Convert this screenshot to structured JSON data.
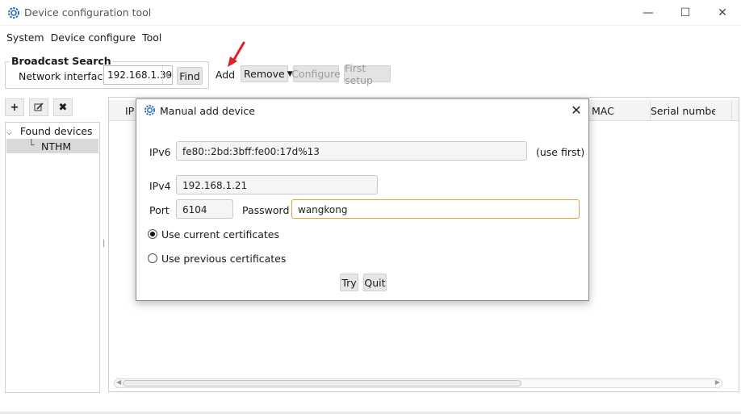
{
  "window": {
    "title": "Device configuration tool",
    "minimize_glyph": "—",
    "maximize_glyph": "☐",
    "close_glyph": "✕"
  },
  "menu": [
    "System",
    "Device configure",
    "Tool"
  ],
  "broadcast": {
    "title": "Broadcast Search",
    "network_label": "Network interface",
    "network_value": "192.168.1.39",
    "find_label": "Find"
  },
  "toolbar": {
    "add_label": "Add",
    "remove_label": "Remove",
    "configure_label": "Configure",
    "first_setup_label": "First setup"
  },
  "tree": {
    "root_label": "Found devices",
    "child_label": "NTHM"
  },
  "table": {
    "columns": [
      "IP",
      "MAC",
      "Serial number"
    ]
  },
  "dialog": {
    "title": "Manual add device",
    "ipv6_label": "IPv6",
    "ipv6_value": "fe80::2bd:3bff:fe00:17d%13",
    "use_first_label": "(use first)",
    "ipv4_label": "IPv4",
    "ipv4_value": "192.168.1.21",
    "port_label": "Port",
    "port_value": "6104",
    "password_label": "Password",
    "password_value": "wangkong",
    "radio_current": "Use current certificates",
    "radio_previous": "Use previous certificates",
    "selected_radio": "current",
    "try_label": "Try",
    "quit_label": "Quit"
  },
  "colors": {
    "accent_focus": "#e0a23c",
    "annotation_arrow": "#e21f26",
    "app_icon": "#2a6db4"
  }
}
